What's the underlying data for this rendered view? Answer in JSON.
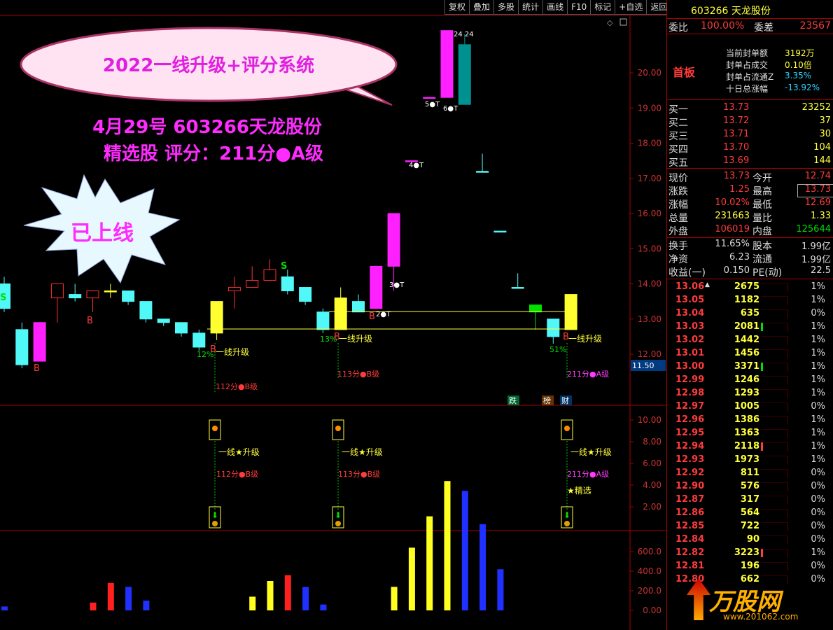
{
  "toolbar": [
    "复权",
    "叠加",
    "多股",
    "统计",
    "画线",
    "F10",
    "标记",
    "+自选",
    "返回"
  ],
  "stock": {
    "code": "603266",
    "name": "天龙股份",
    "header": "603266 天龙股份"
  },
  "committee": {
    "ratio_label": "委比",
    "ratio": "100.00%",
    "diff_label": "委差",
    "diff": "23567"
  },
  "seal": {
    "badge": "首板",
    "rows": [
      {
        "label": "当前封单额",
        "value": "3192万",
        "color": "yel"
      },
      {
        "label": "封单占成交",
        "value": "0.10倍",
        "color": "yel"
      },
      {
        "label": "封单占流通Z",
        "value": "3.35%",
        "color": "cy"
      },
      {
        "label": "十日总涨幅",
        "value": "-13.92%",
        "color": "cy"
      }
    ]
  },
  "bids": [
    {
      "label": "买一",
      "price": "13.73",
      "vol": "23252"
    },
    {
      "label": "买二",
      "price": "13.72",
      "vol": "37"
    },
    {
      "label": "买三",
      "price": "13.71",
      "vol": "30"
    },
    {
      "label": "买四",
      "price": "13.70",
      "vol": "104"
    },
    {
      "label": "买五",
      "price": "13.69",
      "vol": "144"
    }
  ],
  "quote": [
    {
      "l1": "现价",
      "v1": "13.73",
      "c1": "red",
      "l2": "今开",
      "v2": "12.74",
      "c2": "red"
    },
    {
      "l1": "涨跌",
      "v1": "1.25",
      "c1": "red",
      "l2": "最高",
      "v2": "13.73",
      "c2": "red"
    },
    {
      "l1": "涨幅",
      "v1": "10.02%",
      "c1": "red",
      "l2": "最低",
      "v2": "12.69",
      "c2": "red"
    },
    {
      "l1": "总量",
      "v1": "231663",
      "c1": "yel",
      "l2": "量比",
      "v2": "1.33",
      "c2": "yel"
    },
    {
      "l1": "外盘",
      "v1": "106019",
      "c1": "red",
      "l2": "内盘",
      "v2": "125644",
      "c2": "grn"
    }
  ],
  "quote2": [
    {
      "l1": "换手",
      "v1": "11.65%",
      "l2": "股本",
      "v2": "1.99亿"
    },
    {
      "l1": "净资",
      "v1": "6.23",
      "l2": "流通",
      "v2": "1.99亿"
    },
    {
      "l1": "收益(一)",
      "v1": "0.150",
      "l2": "PE(动)",
      "v2": "22.5"
    }
  ],
  "ticks": [
    {
      "p": "13.06",
      "v": "2675",
      "pct": "1%",
      "bar": 0
    },
    {
      "p": "13.05",
      "v": "1182",
      "pct": "1%",
      "bar": 0
    },
    {
      "p": "13.04",
      "v": "635",
      "pct": "0%",
      "bar": 0
    },
    {
      "p": "13.03",
      "v": "2081",
      "pct": "1%",
      "bar": 1
    },
    {
      "p": "13.02",
      "v": "1442",
      "pct": "1%",
      "bar": 0
    },
    {
      "p": "13.01",
      "v": "1456",
      "pct": "1%",
      "bar": 0
    },
    {
      "p": "13.00",
      "v": "3371",
      "pct": "1%",
      "bar": 1
    },
    {
      "p": "12.99",
      "v": "1246",
      "pct": "1%",
      "bar": 0
    },
    {
      "p": "12.98",
      "v": "1293",
      "pct": "1%",
      "bar": 0
    },
    {
      "p": "12.97",
      "v": "1005",
      "pct": "0%",
      "bar": 0
    },
    {
      "p": "12.96",
      "v": "1386",
      "pct": "1%",
      "bar": 0
    },
    {
      "p": "12.95",
      "v": "1363",
      "pct": "1%",
      "bar": 0
    },
    {
      "p": "12.94",
      "v": "2118",
      "pct": "1%",
      "bar": 2
    },
    {
      "p": "12.93",
      "v": "1973",
      "pct": "1%",
      "bar": 0
    },
    {
      "p": "12.92",
      "v": "811",
      "pct": "0%",
      "bar": 0
    },
    {
      "p": "12.90",
      "v": "576",
      "pct": "0%",
      "bar": 0
    },
    {
      "p": "12.87",
      "v": "317",
      "pct": "0%",
      "bar": 0
    },
    {
      "p": "12.86",
      "v": "564",
      "pct": "0%",
      "bar": 0
    },
    {
      "p": "12.85",
      "v": "722",
      "pct": "0%",
      "bar": 0
    },
    {
      "p": "12.84",
      "v": "90",
      "pct": "0%",
      "bar": 0
    },
    {
      "p": "12.82",
      "v": "3223",
      "pct": "1%",
      "bar": 2
    },
    {
      "p": "12.81",
      "v": "196",
      "pct": "0%",
      "bar": 0
    },
    {
      "p": "12.80",
      "v": "662",
      "pct": "0%",
      "bar": 0
    }
  ],
  "promo": {
    "bubble": "2022一线升级+评分系统",
    "line1": "4月29号 603266天龙股份",
    "line2": "精选股  评分：211分●A级",
    "star": "已上线"
  },
  "price_axis": [
    "20.00",
    "19.00",
    "18.00",
    "17.00",
    "16.00",
    "15.00",
    "14.00",
    "13.00",
    "12.00"
  ],
  "price_tag": "11.50",
  "ind_axis": [
    "10.00",
    "8.00",
    "6.00",
    "4.00",
    "2.00"
  ],
  "vol_axis": [
    "600.0",
    "400.0",
    "200.0",
    "0.00"
  ],
  "annotations": {
    "upgrade": "一线升级",
    "upgrade_star": "一线★升级",
    "score1": "112分●B级",
    "score2": "113分●B级",
    "score3": "211分●A级",
    "jingxuan": "★精选",
    "pct1": "12%",
    "pct2": "13%",
    "pct3": "51%",
    "t3": "3●T",
    "t2": "2●T",
    "t4": "4●T",
    "t5": "5●T",
    "t6": "6●T",
    "top_label": "24 24",
    "s": "S",
    "b": "B",
    "badge_die": "跌",
    "badge_bang": "榜",
    "badge_cai": "财"
  },
  "chart_data": {
    "type": "candlestick",
    "ylim": [
      11.5,
      20.5
    ],
    "candles": [
      {
        "o": 14.0,
        "c": 13.3,
        "h": 14.2,
        "l": 13.2,
        "color": "cyan"
      },
      {
        "o": 12.7,
        "c": 11.7,
        "h": 12.9,
        "l": 11.6,
        "color": "cyan"
      },
      {
        "o": 11.8,
        "c": 12.9,
        "h": 12.9,
        "l": 11.8,
        "color": "magenta"
      },
      {
        "o": 13.6,
        "c": 14.0,
        "h": 14.0,
        "l": 12.9,
        "color": "red"
      },
      {
        "o": 13.6,
        "c": 13.7,
        "h": 14.0,
        "l": 13.5,
        "color": "cyan"
      },
      {
        "o": 13.6,
        "c": 13.8,
        "h": 13.8,
        "l": 13.2,
        "color": "red"
      },
      {
        "o": 13.8,
        "c": 13.8,
        "h": 14.0,
        "l": 13.6,
        "color": "yellow"
      },
      {
        "o": 13.8,
        "c": 13.5,
        "h": 13.8,
        "l": 13.4,
        "color": "cyan"
      },
      {
        "o": 13.5,
        "c": 13.0,
        "h": 13.5,
        "l": 12.9,
        "color": "cyan"
      },
      {
        "o": 13.0,
        "c": 12.9,
        "h": 13.0,
        "l": 12.8,
        "color": "cyan"
      },
      {
        "o": 12.9,
        "c": 12.6,
        "h": 12.9,
        "l": 12.5,
        "color": "cyan"
      },
      {
        "o": 12.6,
        "c": 12.2,
        "h": 12.7,
        "l": 12.1,
        "color": "cyan"
      },
      {
        "o": 12.6,
        "c": 13.5,
        "h": 13.5,
        "l": 12.4,
        "color": "yellow"
      },
      {
        "o": 13.8,
        "c": 13.9,
        "h": 14.2,
        "l": 13.3,
        "color": "red"
      },
      {
        "o": 13.9,
        "c": 14.1,
        "h": 14.5,
        "l": 13.9,
        "color": "red"
      },
      {
        "o": 14.1,
        "c": 14.4,
        "h": 14.7,
        "l": 14.1,
        "color": "red"
      },
      {
        "o": 14.2,
        "c": 13.8,
        "h": 14.4,
        "l": 13.7,
        "color": "cyan"
      },
      {
        "o": 13.9,
        "c": 13.5,
        "h": 13.9,
        "l": 13.4,
        "color": "cyan"
      },
      {
        "o": 13.2,
        "c": 12.7,
        "h": 13.3,
        "l": 12.6,
        "color": "cyan"
      },
      {
        "o": 12.7,
        "c": 13.6,
        "h": 13.9,
        "l": 12.7,
        "color": "yellow"
      },
      {
        "o": 13.5,
        "c": 13.2,
        "h": 13.7,
        "l": 13.2,
        "color": "cyan"
      },
      {
        "o": 13.3,
        "c": 14.5,
        "h": 14.5,
        "l": 13.3,
        "color": "magenta"
      },
      {
        "o": 14.5,
        "c": 16.0,
        "h": 16.0,
        "l": 13.8,
        "color": "magenta"
      },
      {
        "o": 17.5,
        "c": 17.5,
        "h": 17.5,
        "l": 17.5,
        "color": "magenta"
      },
      {
        "o": 19.3,
        "c": 19.3,
        "h": 19.3,
        "l": 19.3,
        "color": "magenta"
      },
      {
        "o": 19.3,
        "c": 21.2,
        "h": 21.2,
        "l": 19.3,
        "color": "magenta"
      },
      {
        "o": 20.8,
        "c": 19.1,
        "h": 21.1,
        "l": 19.1,
        "color": "teal"
      },
      {
        "o": 17.2,
        "c": 17.2,
        "h": 17.7,
        "l": 17.2,
        "color": "cyan"
      },
      {
        "o": 15.5,
        "c": 15.5,
        "h": 15.5,
        "l": 15.5,
        "color": "cyan"
      },
      {
        "o": 13.9,
        "c": 13.9,
        "h": 14.3,
        "l": 13.9,
        "color": "cyan"
      },
      {
        "o": 13.2,
        "c": 13.4,
        "h": 13.4,
        "l": 12.7,
        "color": "green"
      },
      {
        "o": 13.0,
        "c": 12.5,
        "h": 13.0,
        "l": 12.3,
        "color": "cyan"
      },
      {
        "o": 12.7,
        "c": 13.7,
        "h": 13.7,
        "l": 12.7,
        "color": "yellow"
      }
    ],
    "volume": [
      {
        "v": 20,
        "color": "blue"
      },
      {
        "v": 0,
        "color": "blue"
      },
      {
        "v": 0,
        "color": "blue"
      },
      {
        "v": 0,
        "color": "blue"
      },
      {
        "v": 0,
        "color": "blue"
      },
      {
        "v": 40,
        "color": "red"
      },
      {
        "v": 140,
        "color": "red"
      },
      {
        "v": 120,
        "color": "blue"
      },
      {
        "v": 50,
        "color": "blue"
      },
      {
        "v": 0,
        "color": "blue"
      },
      {
        "v": 0,
        "color": "blue"
      },
      {
        "v": 0,
        "color": "blue"
      },
      {
        "v": 0,
        "color": "blue"
      },
      {
        "v": 0,
        "color": "blue"
      },
      {
        "v": 70,
        "color": "yellow"
      },
      {
        "v": 150,
        "color": "yellow"
      },
      {
        "v": 180,
        "color": "red"
      },
      {
        "v": 120,
        "color": "blue"
      },
      {
        "v": 30,
        "color": "blue"
      },
      {
        "v": 0,
        "color": "blue"
      },
      {
        "v": 0,
        "color": "blue"
      },
      {
        "v": 0,
        "color": "blue"
      },
      {
        "v": 120,
        "color": "yellow"
      },
      {
        "v": 320,
        "color": "yellow"
      },
      {
        "v": 480,
        "color": "yellow"
      },
      {
        "v": 660,
        "color": "yellow"
      },
      {
        "v": 610,
        "color": "blue"
      },
      {
        "v": 440,
        "color": "blue"
      },
      {
        "v": 210,
        "color": "blue"
      },
      {
        "v": 0,
        "color": "blue"
      },
      {
        "v": 0,
        "color": "blue"
      },
      {
        "v": 0,
        "color": "blue"
      },
      {
        "v": 0,
        "color": "blue"
      }
    ]
  }
}
